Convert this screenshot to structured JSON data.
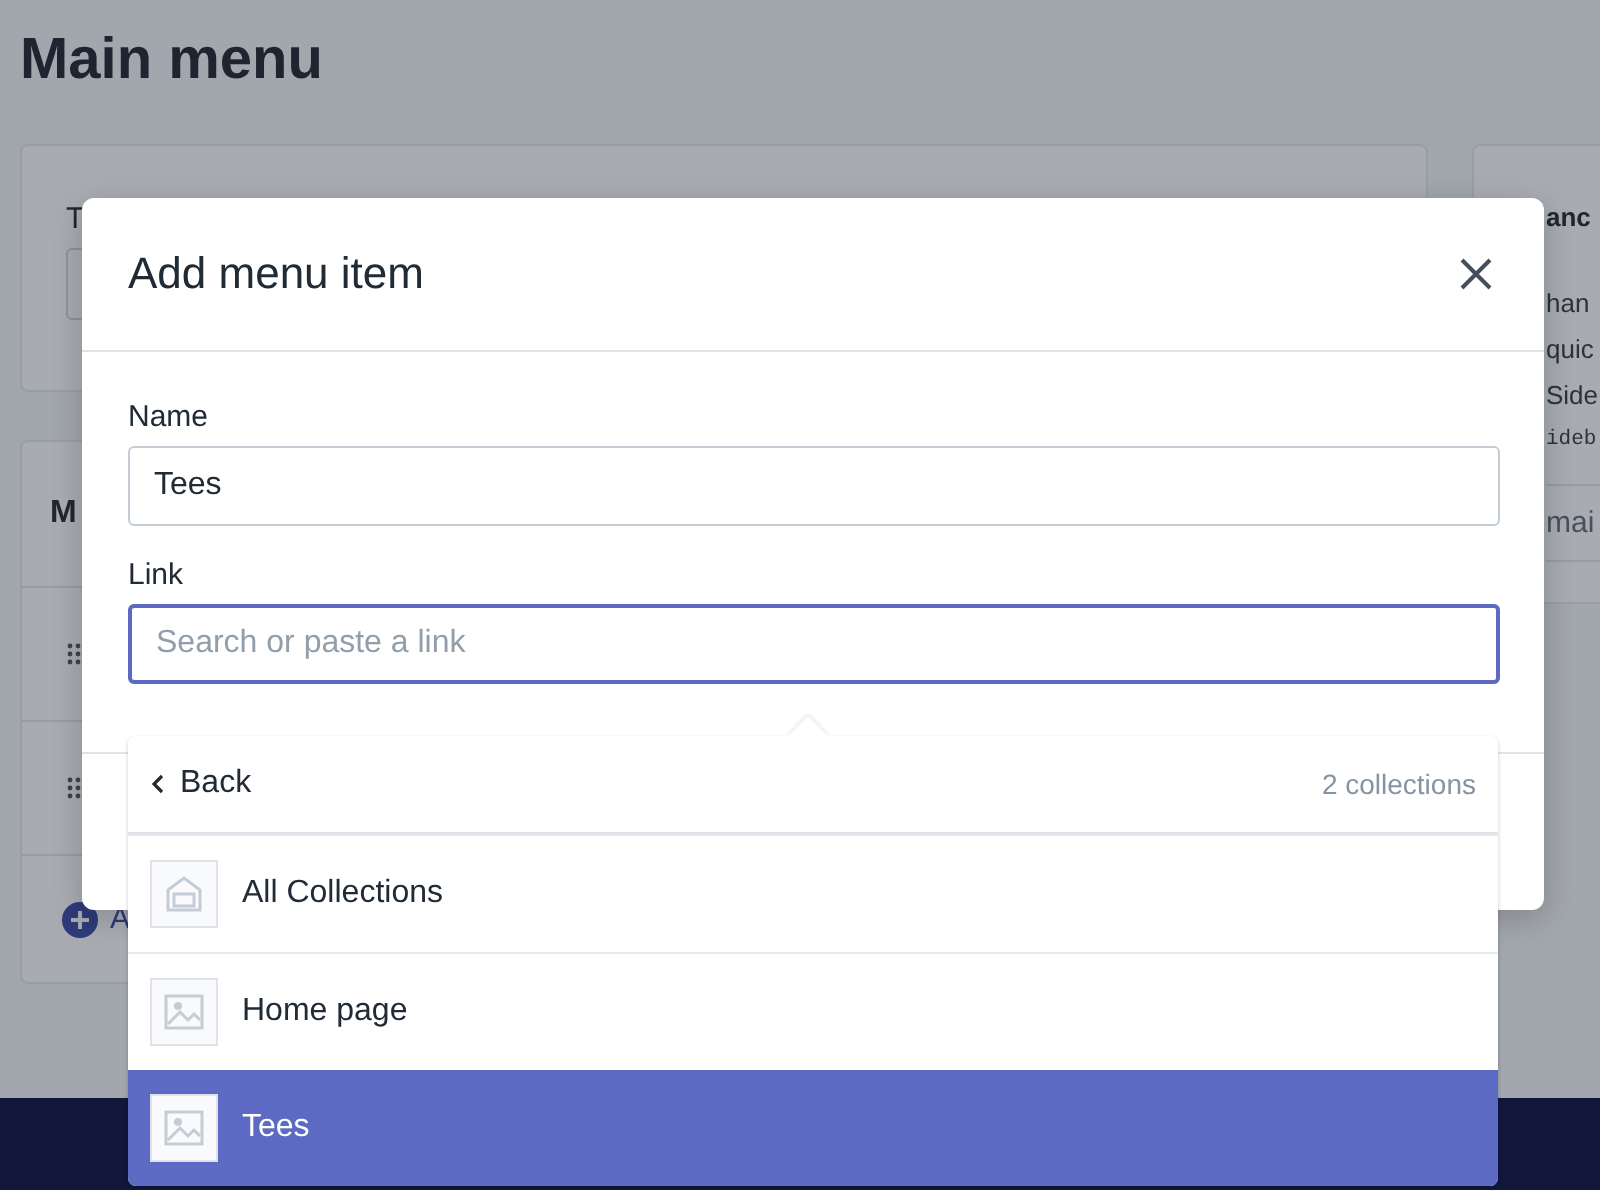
{
  "page": {
    "title": "Main menu"
  },
  "title_card": {
    "label": "T"
  },
  "menu_card": {
    "heading": "M",
    "add_link": "A"
  },
  "side_card": {
    "heading": "anc",
    "lines": [
      "han",
      "quic",
      "Side"
    ],
    "code": "ideb",
    "button": "mai"
  },
  "modal": {
    "title": "Add menu item",
    "fields": [
      {
        "label": "Name",
        "value": "Tees",
        "focused": false
      },
      {
        "label": "Link",
        "placeholder": "Search or paste a link",
        "focused": true
      }
    ]
  },
  "dropdown": {
    "back": "Back",
    "count": "2 collections",
    "items": [
      {
        "label": "All Collections",
        "kind": "collections",
        "selected": false
      },
      {
        "label": "Home page",
        "kind": "image",
        "selected": false
      },
      {
        "label": "Tees",
        "kind": "image",
        "selected": true
      }
    ]
  }
}
